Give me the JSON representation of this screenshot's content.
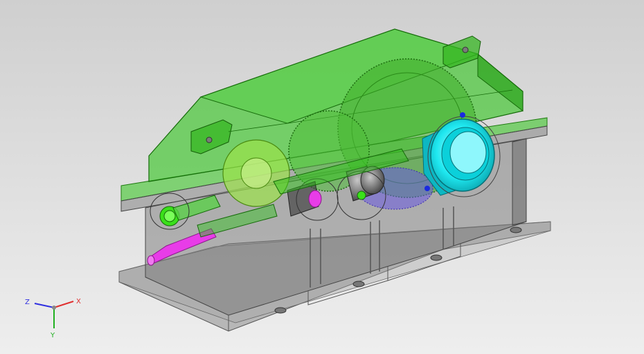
{
  "viewport": {
    "background_top": "#cfcfcf",
    "background_bottom": "#eeeeee",
    "housing_upper_color": "#2fc41a",
    "housing_lower_color": "#8a8a8a",
    "bearing_cap_color": "#1fe8f0",
    "input_shaft_color": "#e83ce8",
    "gear_color": "#7ed321"
  },
  "triad": {
    "x_label": "X",
    "y_label": "Y",
    "z_label": "Z",
    "x_color": "#e03030",
    "y_color": "#20b020",
    "z_color": "#3030e0"
  }
}
